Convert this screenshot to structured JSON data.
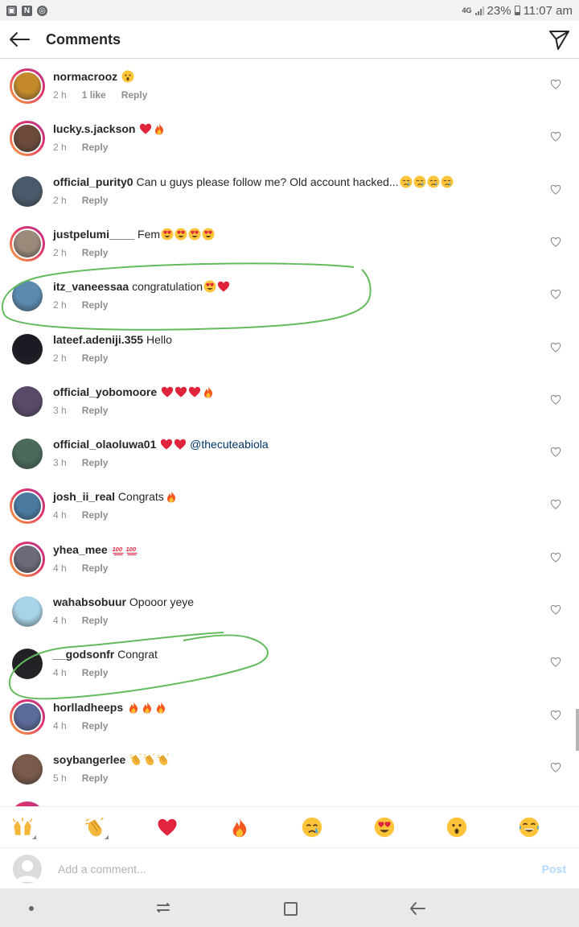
{
  "status_bar": {
    "network": "4G",
    "battery": "23%",
    "time": "11:07 am"
  },
  "header": {
    "title": "Comments"
  },
  "comments": [
    {
      "username": "normacrooz",
      "text": "",
      "emojis": [
        "hushed"
      ],
      "time": "2 h",
      "likes": "1 like",
      "reply": "Reply",
      "ring": true,
      "avatar_color": "#c48a2a"
    },
    {
      "username": "lucky.s.jackson",
      "text": "",
      "emojis": [
        "heart",
        "fire"
      ],
      "time": "2 h",
      "likes": "",
      "reply": "Reply",
      "ring": true,
      "avatar_color": "#6b4a3a"
    },
    {
      "username": "official_purity0",
      "text": "Can u guys please follow me? Old account hacked...",
      "emojis": [
        "cry",
        "cry",
        "cry",
        "cry"
      ],
      "time": "2 h",
      "likes": "",
      "reply": "Reply",
      "ring": false,
      "avatar_color": "#4a5a6a"
    },
    {
      "username": "justpelumi____",
      "text": "Fem",
      "emojis": [
        "hearteyes",
        "hearteyes",
        "hearteyes",
        "hearteyes"
      ],
      "time": "2 h",
      "likes": "",
      "reply": "Reply",
      "ring": true,
      "avatar_color": "#9a8a7a"
    },
    {
      "username": "itz_vaneessaa",
      "text": "congratulation",
      "emojis": [
        "hearteyes",
        "heart"
      ],
      "time": "2 h",
      "likes": "",
      "reply": "Reply",
      "ring": false,
      "avatar_color": "#5a8ab0"
    },
    {
      "username": "lateef.adeniji.355",
      "text": "Hello",
      "emojis": [],
      "time": "2 h",
      "likes": "",
      "reply": "Reply",
      "ring": false,
      "avatar_color": "#1a1a22"
    },
    {
      "username": "official_yobomoore",
      "text": "",
      "emojis": [
        "heart",
        "heart",
        "heart",
        "fire"
      ],
      "time": "3 h",
      "likes": "",
      "reply": "Reply",
      "ring": false,
      "avatar_color": "#5a4a6a"
    },
    {
      "username": "official_olaoluwa01",
      "text": "",
      "emojis": [
        "heart",
        "heart"
      ],
      "mention": "@thecuteabiola",
      "time": "3 h",
      "likes": "",
      "reply": "Reply",
      "ring": false,
      "avatar_color": "#4a6a5a"
    },
    {
      "username": "josh_ii_real",
      "text": "Congrats",
      "emojis": [
        "fire"
      ],
      "time": "4 h",
      "likes": "",
      "reply": "Reply",
      "ring": true,
      "avatar_color": "#4a7aa0"
    },
    {
      "username": "yhea_mee",
      "text": "",
      "emojis": [
        "hundred",
        "hundred"
      ],
      "time": "4 h",
      "likes": "",
      "reply": "Reply",
      "ring": true,
      "avatar_color": "#6a6a7a"
    },
    {
      "username": "wahabsobuur",
      "text": "Opooor yeye",
      "emojis": [],
      "time": "4 h",
      "likes": "",
      "reply": "Reply",
      "ring": false,
      "avatar_color": "#a8d4e8"
    },
    {
      "username": "__godsonfr",
      "text": "Congrat",
      "emojis": [],
      "time": "4 h",
      "likes": "",
      "reply": "Reply",
      "ring": false,
      "avatar_color": "#222226"
    },
    {
      "username": "horlladheeps",
      "text": "",
      "emojis": [
        "fire",
        "fire",
        "fire"
      ],
      "time": "4 h",
      "likes": "",
      "reply": "Reply",
      "ring": true,
      "avatar_color": "#5a6a9a"
    },
    {
      "username": "soybangerlee",
      "text": "",
      "emojis": [
        "clap",
        "clap",
        "clap"
      ],
      "time": "5 h",
      "likes": "",
      "reply": "Reply",
      "ring": false,
      "avatar_color": "#7a5a4a"
    }
  ],
  "quick_emojis": [
    "raised-hands",
    "clap",
    "heart",
    "fire",
    "cry",
    "hearteyes",
    "hushed",
    "joy"
  ],
  "comment_box": {
    "placeholder": "Add a comment...",
    "post_label": "Post"
  },
  "colors": {
    "ring_start": "#f9a53a",
    "ring_end": "#b2398d",
    "mention": "#003569",
    "post_disabled": "#b3dbff",
    "annotation": "#63bb5e"
  }
}
